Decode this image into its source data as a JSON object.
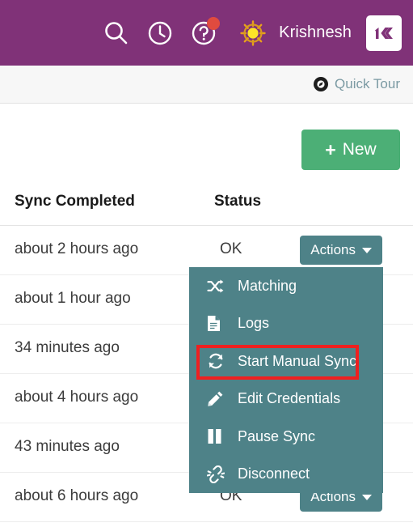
{
  "header": {
    "background_color": "#803278",
    "icons": [
      {
        "name": "search-icon",
        "label": "Search"
      },
      {
        "name": "history-clock-icon",
        "label": "Recent"
      },
      {
        "name": "help-question-icon",
        "label": "Help",
        "badge": true
      }
    ],
    "badge_color": "#e04b3f",
    "sun_icon": "sun-icon",
    "username": "Krishnesh",
    "logo_text": "1K"
  },
  "tourbar": {
    "icon": "compass-icon",
    "label": "Quick Tour",
    "label_color": "#7b9aa3"
  },
  "toolbar": {
    "new_label": "New",
    "new_plus": "+",
    "new_color": "#4caf76"
  },
  "table": {
    "columns": [
      "Sync Completed",
      "Status"
    ],
    "action_label": "Actions",
    "action_color": "#4e8288",
    "rows": [
      {
        "sync_completed": "about 2 hours ago",
        "status": "OK",
        "action": "Actions"
      },
      {
        "sync_completed": "about 1 hour ago",
        "status": "",
        "action": ""
      },
      {
        "sync_completed": "34 minutes ago",
        "status": "",
        "action": ""
      },
      {
        "sync_completed": "about 4 hours ago",
        "status": "",
        "action": ""
      },
      {
        "sync_completed": "43 minutes ago",
        "status": "",
        "action": ""
      },
      {
        "sync_completed": "about 6 hours ago",
        "status": "OK",
        "action": "Actions"
      }
    ]
  },
  "dropdown": {
    "background_color": "#4e8288",
    "highlight_color": "#ee2020",
    "highlighted_index": 2,
    "items": [
      {
        "label": "Matching",
        "icon": "shuffle-icon"
      },
      {
        "label": "Logs",
        "icon": "document-icon"
      },
      {
        "label": "Start Manual Sync",
        "icon": "refresh-sync-icon"
      },
      {
        "label": "Edit Credentials",
        "icon": "pencil-icon"
      },
      {
        "label": "Pause Sync",
        "icon": "pause-icon"
      },
      {
        "label": "Disconnect",
        "icon": "broken-link-icon"
      }
    ]
  }
}
